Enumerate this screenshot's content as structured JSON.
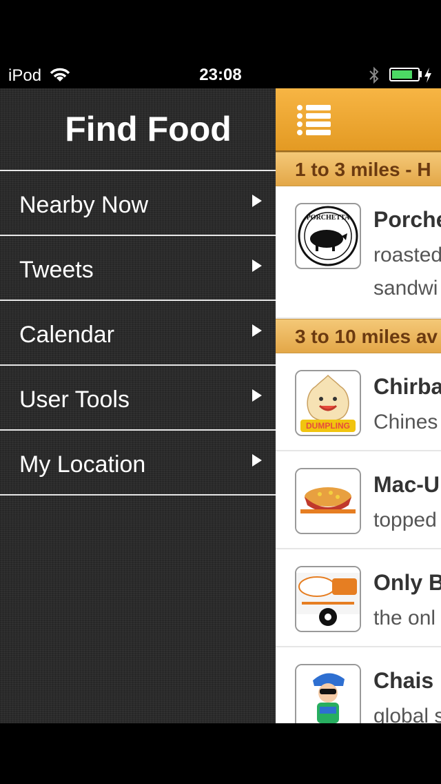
{
  "status_bar": {
    "carrier": "iPod",
    "time": "23:08",
    "battery_percent": 80
  },
  "sidebar": {
    "title": "Find Food",
    "items": [
      {
        "label": "Nearby Now",
        "icon": "chevron-right-icon"
      },
      {
        "label": "Tweets",
        "icon": "chevron-right-icon"
      },
      {
        "label": "Calendar",
        "icon": "chevron-right-icon"
      },
      {
        "label": "User Tools",
        "icon": "chevron-right-icon"
      },
      {
        "label": "My Location",
        "icon": "chevron-right-icon"
      }
    ]
  },
  "main": {
    "menu_icon": "hamburger-menu-icon",
    "sections": [
      {
        "header": "1 to 3 miles - H"
      },
      {
        "header": "3 to 10 miles av"
      }
    ],
    "vendors": [
      {
        "name": "Porche",
        "desc": "roasted\nsandwi",
        "logo": "porchetta-pig-logo"
      },
      {
        "name": "Chirba",
        "desc": "Chines",
        "logo": "chirba-dumpling-logo"
      },
      {
        "name": "Mac-U",
        "desc": "topped",
        "logo": "mac-n-cheese-logo"
      },
      {
        "name": "Only B",
        "desc": "the onl",
        "logo": "only-burger-logo"
      },
      {
        "name": "Chais",
        "desc": "global s",
        "logo": "chef-mascot-logo"
      }
    ]
  },
  "colors": {
    "accent": "#f0a83a",
    "section_text": "#6b3a10",
    "sidebar_bg": "#2b2b2b",
    "battery": "#4cd964"
  }
}
